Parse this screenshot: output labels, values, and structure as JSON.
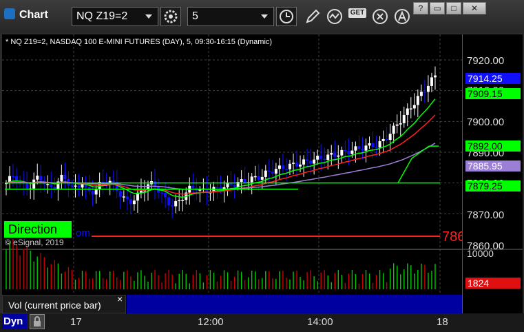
{
  "app": {
    "title": "Chart"
  },
  "toolbar": {
    "symbol_value": "NQ Z19=2",
    "interval_value": "5",
    "get_label": "GET"
  },
  "window_controls": {
    "help": "?",
    "minimize": "▭",
    "maximize": "□",
    "close": "✕"
  },
  "chart": {
    "info_line": "* NQ Z19=2, NASDAQ 100 E-MINI FUTURES (DAY), 5, 09:30-16:15 (Dynamic)",
    "direction_label": "Direction",
    "direction_suffix": "om",
    "copyright": "© eSignal, 2019",
    "red_line_label": "786",
    "price_labels": [
      "7920.00",
      "7910.00",
      "7900.00",
      "7890.00",
      "7880.00",
      "7870.00",
      "7860.00"
    ],
    "price_tags": [
      {
        "value": "7914.25",
        "bg": "#1010ff",
        "fg": "#ffffff"
      },
      {
        "value": "7909.15",
        "bg": "#00ff00",
        "fg": "#000000"
      },
      {
        "value": "7892.00",
        "bg": "#00ff00",
        "fg": "#000000"
      },
      {
        "value": "7885.95",
        "bg": "#9b7fd6",
        "fg": "#ffffff"
      },
      {
        "value": "7879.25",
        "bg": "#00ff00",
        "fg": "#000000"
      }
    ],
    "volume_labels": [
      "10000",
      "1824"
    ],
    "vol_tag_color": "#e01010",
    "vol_panel_label": "Vol (current price bar)",
    "vol_close": "×",
    "time_labels": [
      "17",
      "12:00",
      "14:00",
      "18"
    ],
    "dyn_label": "Dyn"
  },
  "colors": {
    "up": "#ffffff",
    "down": "#1010ff",
    "ma_fast": "#00ff00",
    "ma_red": "#ff2020",
    "ma_purple": "#9b7fd6"
  }
}
